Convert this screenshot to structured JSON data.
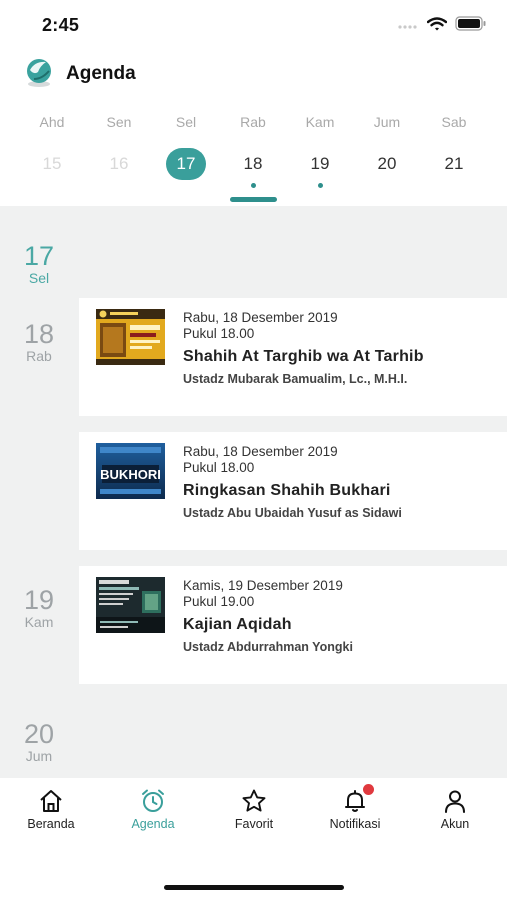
{
  "status_bar": {
    "time": "2:45"
  },
  "header": {
    "title": "Agenda"
  },
  "week": [
    {
      "name": "Ahd",
      "num": "15",
      "state": "past",
      "has_event": false
    },
    {
      "name": "Sen",
      "num": "16",
      "state": "past",
      "has_event": false
    },
    {
      "name": "Sel",
      "num": "17",
      "state": "selected",
      "has_event": false
    },
    {
      "name": "Rab",
      "num": "18",
      "state": "normal",
      "has_event": true
    },
    {
      "name": "Kam",
      "num": "19",
      "state": "normal",
      "has_event": true
    },
    {
      "name": "Jum",
      "num": "20",
      "state": "normal",
      "has_event": false
    },
    {
      "name": "Sab",
      "num": "21",
      "state": "normal",
      "has_event": false
    }
  ],
  "agenda": {
    "markers": [
      {
        "num": "17",
        "day": "Sel",
        "today": true
      },
      {
        "num": "18",
        "day": "Rab",
        "today": false
      },
      {
        "num": "19",
        "day": "Kam",
        "today": false
      },
      {
        "num": "20",
        "day": "Jum",
        "today": false
      }
    ],
    "events": [
      {
        "date": "Rabu, 18 Desember 2019",
        "time": "Pukul 18.00",
        "title": "Shahih At Targhib wa At Tarhib",
        "speaker": "Ustadz Mubarak Bamualim, Lc., M.H.I.",
        "thumb": "poster-yellow"
      },
      {
        "date": "Rabu, 18 Desember 2019",
        "time": "Pukul 18.00",
        "title": "Ringkasan Shahih Bukhari",
        "speaker": "Ustadz Abu Ubaidah Yusuf as Sidawi",
        "thumb": "poster-bukhori",
        "thumb_text": "BUKHORI"
      },
      {
        "date": "Kamis, 19 Desember 2019",
        "time": "Pukul 19.00",
        "title": "Kajian Aqidah",
        "speaker": "Ustadz Abdurrahman Yongki",
        "thumb": "poster-dark"
      }
    ]
  },
  "tabbar": [
    {
      "label": "Beranda",
      "icon": "home-icon",
      "active": false
    },
    {
      "label": "Agenda",
      "icon": "alarm-clock-icon",
      "active": true
    },
    {
      "label": "Favorit",
      "icon": "star-icon",
      "active": false
    },
    {
      "label": "Notifikasi",
      "icon": "bell-icon",
      "active": false,
      "badge": true
    },
    {
      "label": "Akun",
      "icon": "user-icon",
      "active": false
    }
  ],
  "colors": {
    "accent": "#3a9f9b",
    "badge": "#e0393e",
    "list_bg": "#f0f1f1"
  }
}
